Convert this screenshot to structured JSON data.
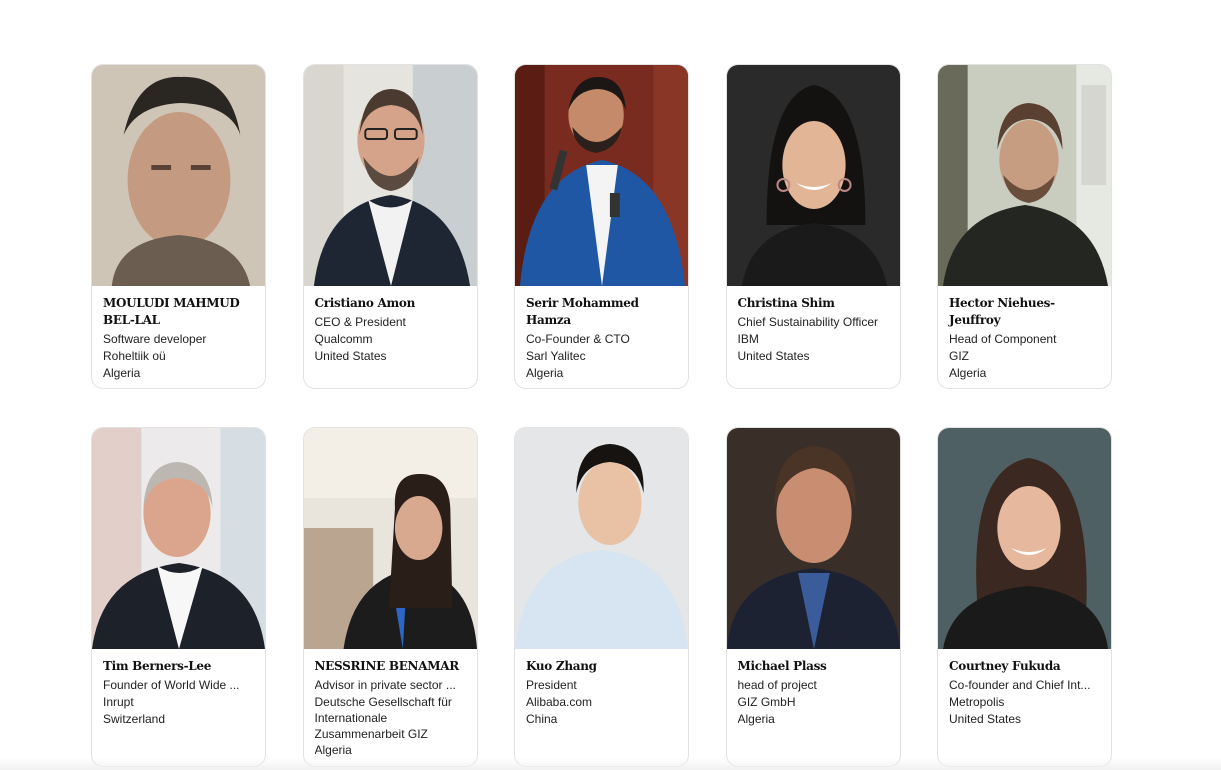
{
  "speakers": [
    {
      "name": "MOULUDI MAHMUD BEL-LAL",
      "title": "Software developer",
      "org": "Roheltiik oü",
      "country": "Algeria"
    },
    {
      "name": "Cristiano Amon",
      "title": "CEO & President",
      "org": "Qualcomm",
      "country": "United States"
    },
    {
      "name": "Serir Mohammed Hamza",
      "title": "Co-Founder & CTO",
      "org": "Sarl Yalitec",
      "country": "Algeria"
    },
    {
      "name": "Christina Shim",
      "title": "Chief Sustainability Officer",
      "org": "IBM",
      "country": "United States"
    },
    {
      "name": "Hector Niehues-Jeuffroy",
      "title": "Head of Component",
      "org": "GIZ",
      "country": "Algeria"
    },
    {
      "name": "Tim Berners-Lee",
      "title": "Founder of World Wide ...",
      "org": "Inrupt",
      "country": "Switzerland"
    },
    {
      "name": "NESSRINE BENAMAR",
      "title": "Advisor in private sector ...",
      "org": "Deutsche Gesellschaft für Internationale Zusammenarbeit GIZ",
      "country": "Algeria"
    },
    {
      "name": "Kuo Zhang",
      "title": "President",
      "org": "Alibaba.com",
      "country": "China"
    },
    {
      "name": "Michael Plass",
      "title": "head of project",
      "org": "GIZ GmbH",
      "country": "Algeria"
    },
    {
      "name": "Courtney Fukuda",
      "title": "Co-founder and Chief Int...",
      "org": "Metropolis",
      "country": "United States"
    }
  ]
}
